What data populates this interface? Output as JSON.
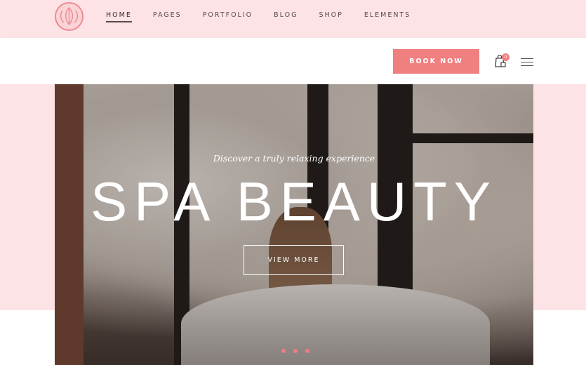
{
  "nav": {
    "items": [
      {
        "label": "HOME",
        "active": true
      },
      {
        "label": "PAGES"
      },
      {
        "label": "PORTFOLIO"
      },
      {
        "label": "BLOG"
      },
      {
        "label": "SHOP"
      },
      {
        "label": "ELEMENTS"
      }
    ]
  },
  "header": {
    "book_label": "BOOK NOW",
    "cart_count": "0",
    "cart_icon": "shopping-bag-icon",
    "menu_icon": "hamburger-icon"
  },
  "hero": {
    "subtitle": "Discover a truly relaxing experience",
    "title": "SPA BEAUTY",
    "button_label": "VIEW MORE",
    "slides": 3
  },
  "colors": {
    "accent": "#f07f80",
    "topbar": "#fde3e6"
  }
}
